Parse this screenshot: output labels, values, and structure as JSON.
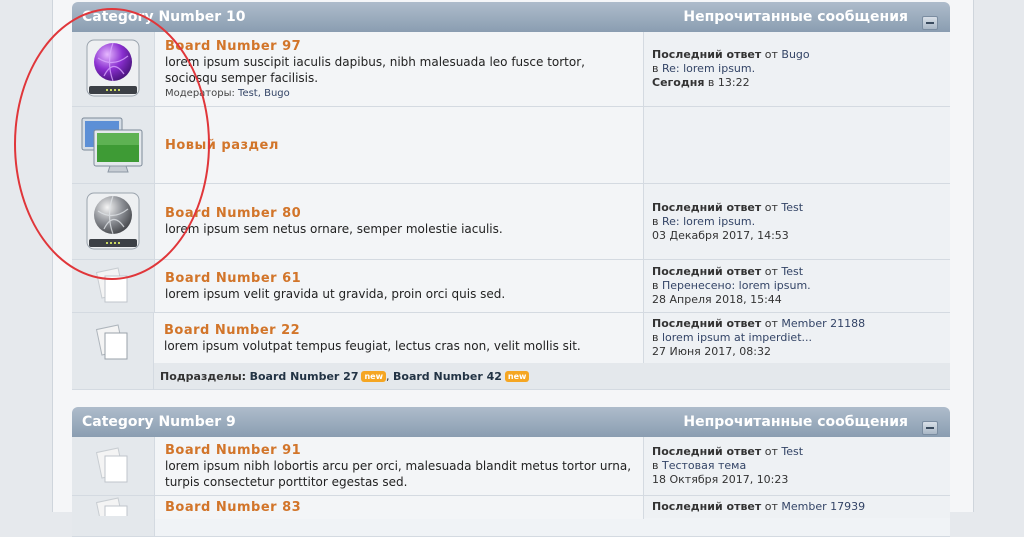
{
  "categories": [
    {
      "title": "Category Number 10",
      "unread_label": "Непрочитанные сообщения",
      "boards": [
        {
          "icon": "purple-globe-drive-icon",
          "name": "Board Number 97",
          "desc": "lorem ipsum suscipit iaculis dapibus, nibh malesuada leo fusce tortor, sociosqu semper facilisis.",
          "mods_label": "Модераторы:",
          "mods": "Test, Bugo",
          "last_label": "Последний ответ",
          "from_word": "от",
          "author": "Bugo",
          "in_word": "в",
          "topic": "Re: lorem ipsum.",
          "date_bold": "Сегодня",
          "date_rest": "в 13:22"
        },
        {
          "icon": "monitors-icon",
          "name": "Новый раздел"
        },
        {
          "icon": "gray-globe-drive-icon",
          "name": "Board Number 80",
          "desc": "lorem ipsum sem netus ornare, semper molestie iaculis.",
          "last_label": "Последний ответ",
          "from_word": "от",
          "author": "Test",
          "in_word": "в",
          "topic": "Re: lorem ipsum.",
          "date": "03 Декабря 2017, 14:53"
        },
        {
          "icon": "read-pages-icon",
          "name": "Board Number 61",
          "desc": "lorem ipsum velit gravida ut gravida, proin orci quis sed.",
          "last_label": "Последний ответ",
          "from_word": "от",
          "author": "Test",
          "in_word": "в",
          "topic": "Перенесено: lorem ipsum.",
          "date": "28 Апреля 2018, 15:44"
        },
        {
          "icon": "read-pages-icon",
          "name": "Board Number 22",
          "desc": "lorem ipsum volutpat tempus feugiat, lectus cras non, velit mollis sit.",
          "last_label": "Последний ответ",
          "from_word": "от",
          "author": "Member 21188",
          "in_word": "в",
          "topic": "lorem ipsum at imperdiet...",
          "date": "27 Июня 2017, 08:32"
        }
      ],
      "subboards_label": "Подразделы:",
      "subboards": [
        {
          "name": "Board Number 27",
          "badge": "new"
        },
        {
          "name": "Board Number 42",
          "badge": "new"
        }
      ]
    },
    {
      "title": "Category Number 9",
      "unread_label": "Непрочитанные сообщения",
      "boards": [
        {
          "icon": "read-pages-icon",
          "name": "Board Number 91",
          "desc": "lorem ipsum nibh lobortis arcu per orci, malesuada blandit metus tortor urna, turpis consectetur porttitor egestas sed.",
          "last_label": "Последний ответ",
          "from_word": "от",
          "author": "Test",
          "in_word": "в",
          "topic": "Тестовая тема",
          "date": "18 Октября 2017, 10:23"
        },
        {
          "icon": "read-pages-icon",
          "name": "Board Number 83",
          "last_label": "Последний ответ",
          "from_word": "от",
          "author": "Member 17939"
        }
      ]
    }
  ],
  "colors": {
    "highlight_ring": "#e0363a",
    "board_link": "#d2752a",
    "header": "#8a9db1"
  }
}
